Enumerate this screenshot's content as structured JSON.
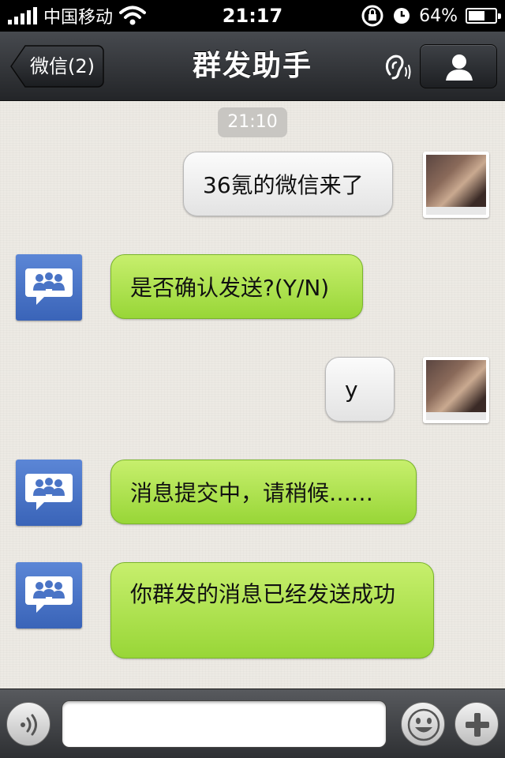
{
  "status_bar": {
    "carrier": "中国移动",
    "time": "21:17",
    "battery_percent": "64%",
    "battery_level": 0.64,
    "icons": [
      "signal-icon",
      "wifi-icon",
      "orientation-lock-icon",
      "alarm-clock-icon",
      "battery-icon"
    ]
  },
  "nav": {
    "back_label": "微信(2)",
    "title": "群发助手",
    "icons": [
      "ear-icon",
      "contact-icon"
    ]
  },
  "chat": {
    "timestamp": "21:10",
    "messages": [
      {
        "side": "right",
        "text": "36氪的微信来了"
      },
      {
        "side": "left",
        "text": "是否确认发送?(Y/N)"
      },
      {
        "side": "right",
        "text": "y"
      },
      {
        "side": "left",
        "text": "消息提交中，请稍候……"
      },
      {
        "side": "left",
        "text": "你群发的消息已经发送成功"
      }
    ]
  },
  "input_bar": {
    "value": "",
    "icons": [
      "voice-icon",
      "emoji-icon",
      "plus-icon"
    ]
  },
  "colors": {
    "green_bubble": "#b4e452",
    "gray_bubble": "#f0f0f0",
    "group_avatar": "#4a74c6",
    "nav_bar": "#2f3236"
  }
}
